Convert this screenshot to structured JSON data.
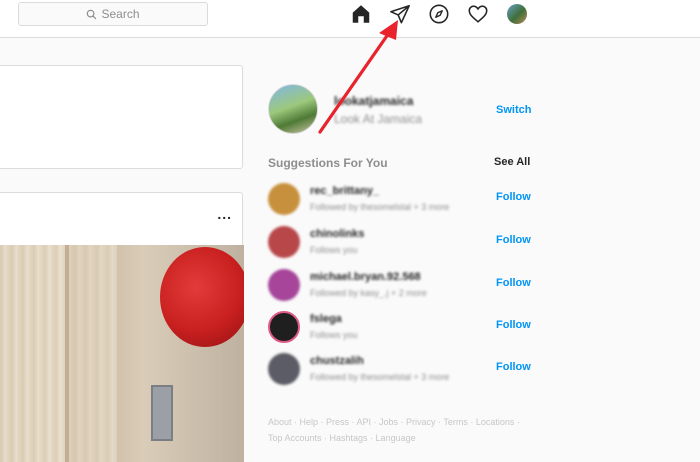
{
  "search": {
    "placeholder": "Search"
  },
  "nav": {
    "icons": [
      "home-icon",
      "direct-message-icon",
      "explore-compass-icon",
      "activity-heart-icon",
      "profile-avatar-icon"
    ]
  },
  "profile": {
    "username": "lookatjamaica",
    "full_name": "Look At Jamaica",
    "switch_label": "Switch"
  },
  "suggestions": {
    "title": "Suggestions For You",
    "see_all": "See All",
    "items": [
      {
        "username": "rec_brittany_",
        "subtitle": "Followed by thesomelstal + 3 more",
        "follow_label": "Follow",
        "avatar_color": "#c7903c"
      },
      {
        "username": "chinolinks",
        "subtitle": "Follows you",
        "follow_label": "Follow",
        "avatar_color": "#b8474a"
      },
      {
        "username": "michael.bryan.92.568",
        "subtitle": "Followed by kasy_.j + 2 more",
        "follow_label": "Follow",
        "avatar_color": "#a6459a"
      },
      {
        "username": "fslega",
        "subtitle": "Follows you",
        "follow_label": "Follow",
        "avatar_color": "#1f1f1f"
      },
      {
        "username": "chustzalih",
        "subtitle": "Followed by thesomelstal + 3 more",
        "follow_label": "Follow",
        "avatar_color": "#5c5c66"
      }
    ]
  },
  "post": {
    "more_label": "..."
  },
  "footer": {
    "line1": "About · Help · Press · API · Jobs · Privacy · Terms · Locations ·",
    "line2": "Top Accounts · Hashtags · Language"
  },
  "colors": {
    "accent_blue": "#0095f6",
    "annotation_arrow": "#e8232c"
  }
}
